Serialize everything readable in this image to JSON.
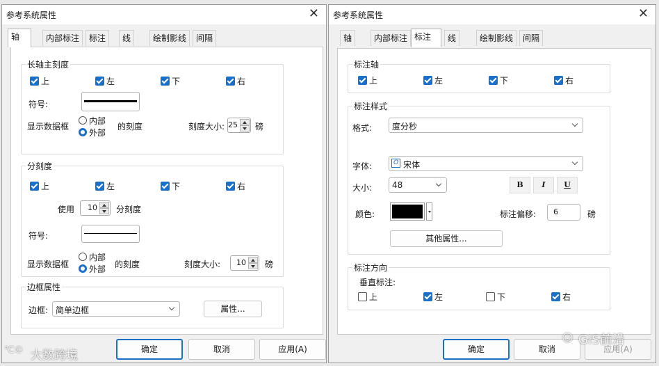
{
  "left_dialog": {
    "title": "参考系统属性",
    "close_glyph": "✕",
    "tabs": [
      "轴",
      "内部标注",
      "标注",
      "线",
      "绘制影线",
      "间隔"
    ],
    "active_tab": "轴",
    "major": {
      "title": "长轴主刻度",
      "checks": [
        {
          "label": "上",
          "checked": true
        },
        {
          "label": "左",
          "checked": true
        },
        {
          "label": "下",
          "checked": true
        },
        {
          "label": "右",
          "checked": true
        }
      ],
      "symbol_label": "符号:",
      "show_label": "显示数据框",
      "radio_inner": "内部",
      "radio_outer": "外部",
      "radio_selected": "外部",
      "ticks_suffix": "的刻度",
      "tick_size_label": "刻度大小:",
      "tick_size": "25",
      "unit": "磅"
    },
    "minor": {
      "title": "分刻度",
      "checks": [
        {
          "label": "上",
          "checked": true
        },
        {
          "label": "左",
          "checked": true
        },
        {
          "label": "下",
          "checked": true
        },
        {
          "label": "右",
          "checked": true
        }
      ],
      "use_label": "使用",
      "count": "10",
      "count_suffix": "分刻度",
      "symbol_label": "符号:",
      "show_label": "显示数据框",
      "radio_inner": "内部",
      "radio_outer": "外部",
      "radio_selected": "外部",
      "ticks_suffix": "的刻度",
      "tick_size_label": "刻度大小:",
      "tick_size": "10",
      "unit": "磅"
    },
    "frame": {
      "title": "边框属性",
      "label": "边框:",
      "value": "简单边框",
      "props_button": "属性..."
    },
    "buttons": {
      "ok": "确定",
      "cancel": "取消",
      "apply": "应用(A)"
    }
  },
  "right_dialog": {
    "title": "参考系统属性",
    "close_glyph": "✕",
    "tabs": [
      "轴",
      "内部标注",
      "标注",
      "线",
      "绘制影线",
      "间隔"
    ],
    "active_tab": "标注",
    "label_axes": {
      "title": "标注轴",
      "checks": [
        {
          "label": "上",
          "checked": true
        },
        {
          "label": "左",
          "checked": true
        },
        {
          "label": "下",
          "checked": true
        },
        {
          "label": "右",
          "checked": true
        }
      ]
    },
    "label_style": {
      "title": "标注样式",
      "format_label": "格式:",
      "format_value": "度分秒",
      "font_label": "字体:",
      "font_icon_glyph": "O",
      "font_value": "宋体",
      "size_label": "大小:",
      "size_value": "48",
      "bold": "B",
      "italic": "I",
      "underline": "U",
      "color_label": "颜色:",
      "color_value": "#000000",
      "offset_label": "标注偏移:",
      "offset_value": "6",
      "unit": "磅",
      "more_button": "其他属性..."
    },
    "label_direction": {
      "title": "标注方向",
      "vertical_label": "垂直标注:",
      "checks": [
        {
          "label": "上",
          "checked": false
        },
        {
          "label": "左",
          "checked": true
        },
        {
          "label": "下",
          "checked": false
        },
        {
          "label": "右",
          "checked": true
        }
      ]
    },
    "buttons": {
      "ok": "确定",
      "cancel": "取消",
      "apply": "应用(A)"
    }
  },
  "watermarks": {
    "left_logo": "℃©",
    "left": "大数跨境",
    "right_logo": "☺",
    "right": "GIS前沿"
  },
  "colors": {
    "accent": "#1a6fc9",
    "panel": "#ffffff",
    "chrome": "#f0f0f0"
  }
}
